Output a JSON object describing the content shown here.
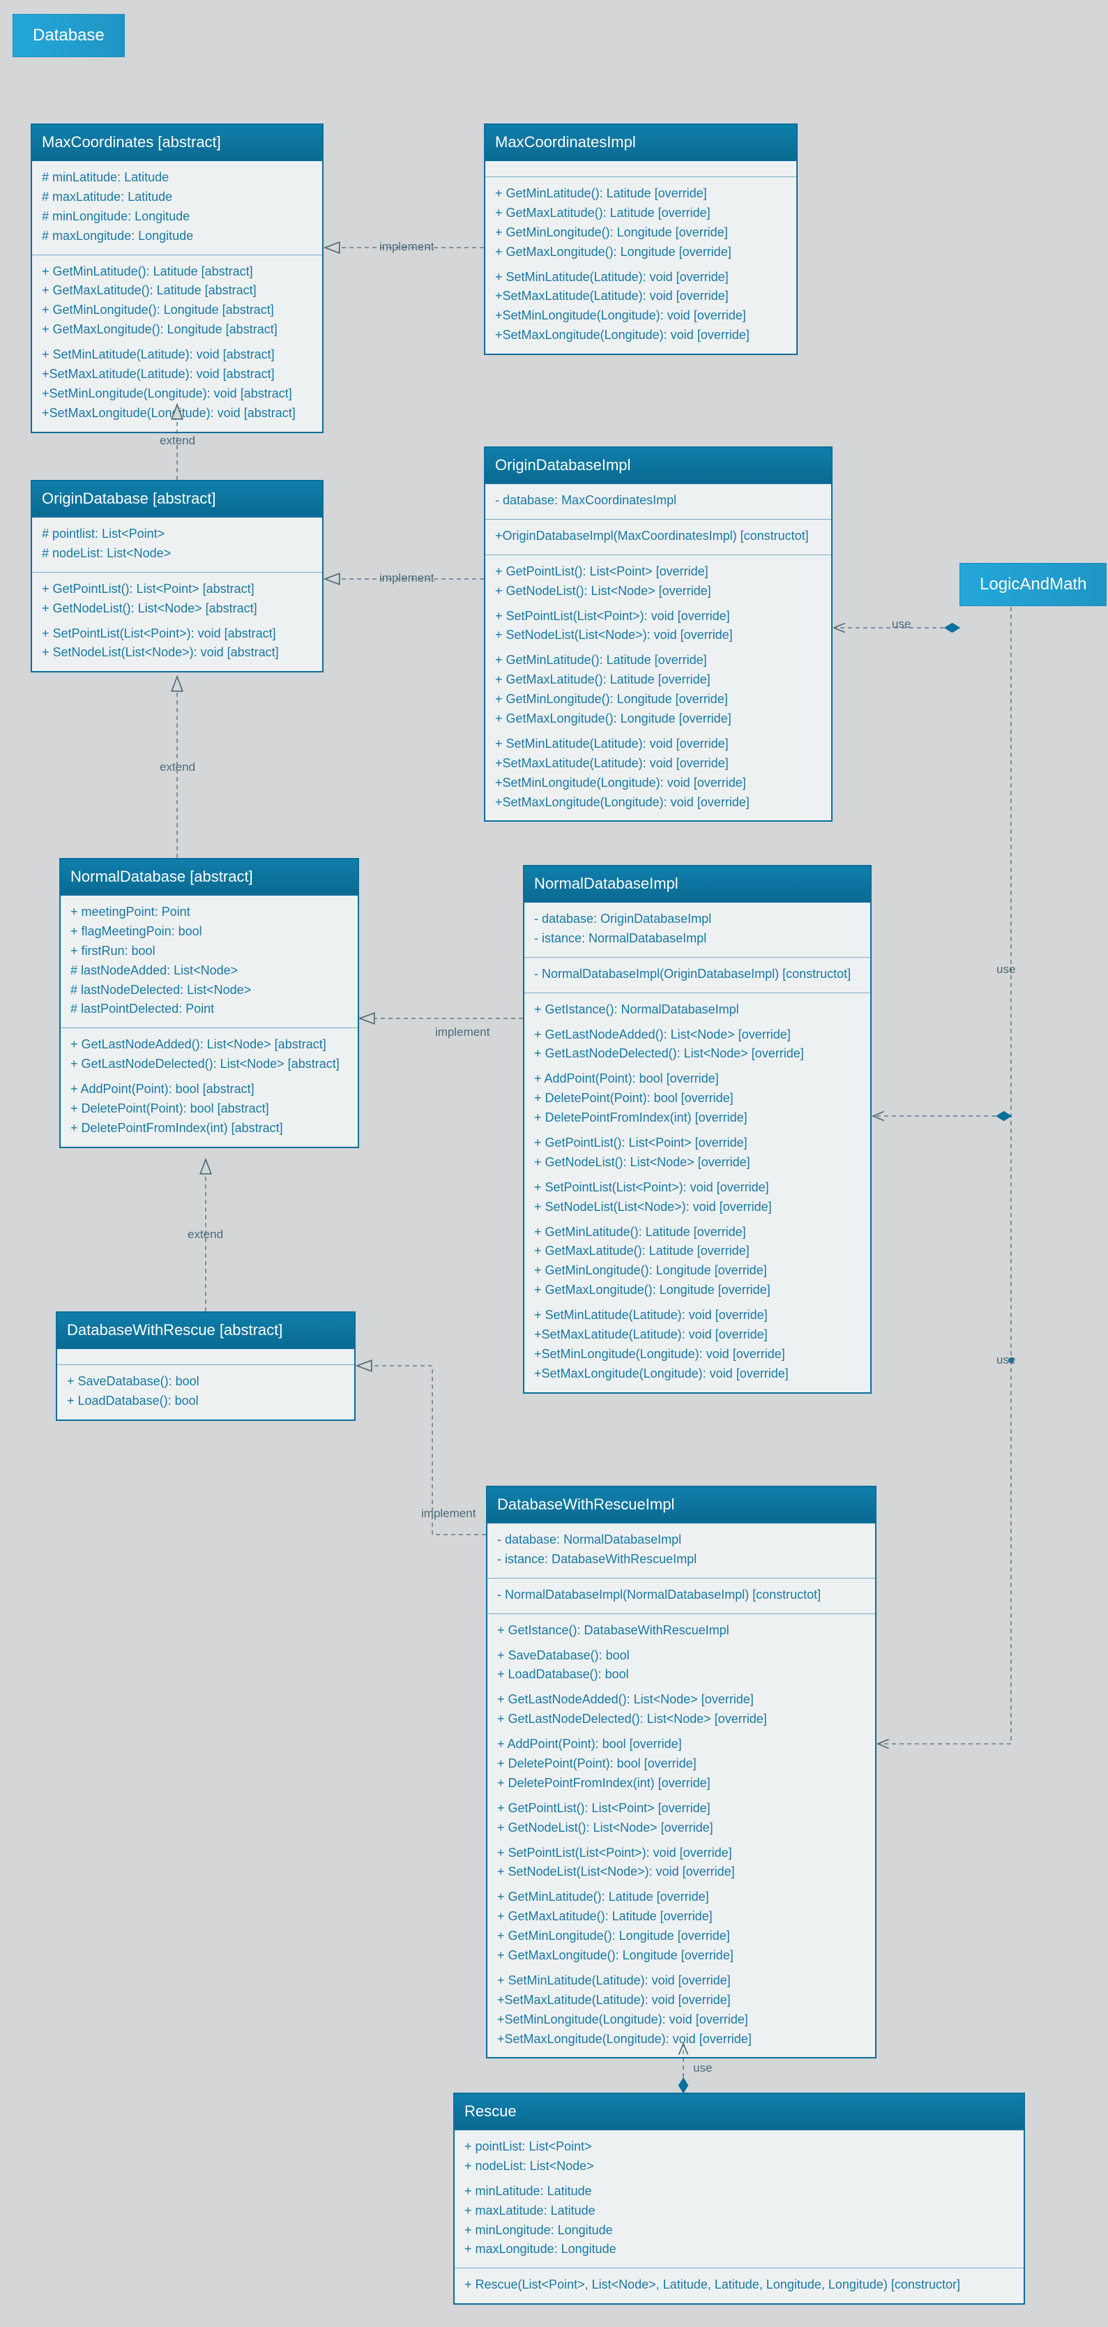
{
  "packages": {
    "database": "Database",
    "logicAndMath": "LogicAndMath"
  },
  "edges": {
    "implement": "implement",
    "extend": "extend",
    "use": "use"
  },
  "classes": {
    "MaxCoordinates": {
      "title": "MaxCoordinates [abstract]",
      "fields": [
        "# minLatitude: Latitude",
        "# maxLatitude: Latitude",
        "# minLongitude: Longitude",
        "# maxLongitude: Longitude"
      ],
      "methods1": [
        "+ GetMinLatitude(): Latitude [abstract]",
        "+ GetMaxLatitude(): Latitude [abstract]",
        "+ GetMinLongitude(): Longitude [abstract]",
        "+ GetMaxLongitude(): Longitude [abstract]"
      ],
      "methods2": [
        "+ SetMinLatitude(Latitude): void [abstract]",
        "+SetMaxLatitude(Latitude): void [abstract]",
        "+SetMinLongitude(Longitude): void [abstract]",
        "+SetMaxLongitude(Longitude): void [abstract]"
      ]
    },
    "MaxCoordinatesImpl": {
      "title": "MaxCoordinatesImpl",
      "methods1": [
        "+ GetMinLatitude(): Latitude [override]",
        "+ GetMaxLatitude(): Latitude [override]",
        "+ GetMinLongitude(): Longitude [override]",
        "+ GetMaxLongitude(): Longitude [override]"
      ],
      "methods2": [
        "+ SetMinLatitude(Latitude): void [override]",
        "+SetMaxLatitude(Latitude): void [override]",
        "+SetMinLongitude(Longitude): void [override]",
        "+SetMaxLongitude(Longitude): void [override]"
      ]
    },
    "OriginDatabase": {
      "title": "OriginDatabase [abstract]",
      "fields": [
        "#  pointlist: List<Point>",
        "# nodeList: List<Node>"
      ],
      "methods1": [
        "+ GetPointList(): List<Point> [abstract]",
        "+ GetNodeList(): List<Node> [abstract]"
      ],
      "methods2": [
        "+ SetPointList(List<Point>): void [abstract]",
        "+ SetNodeList(List<Node>): void [abstract]"
      ]
    },
    "OriginDatabaseImpl": {
      "title": "OriginDatabaseImpl",
      "fields": [
        "- database: MaxCoordinatesImpl"
      ],
      "ctor": [
        "+OriginDatabaseImpl(MaxCoordinatesImpl) [constructot]"
      ],
      "m1": [
        "+ GetPointList(): List<Point> [override]",
        "+ GetNodeList(): List<Node> [override]"
      ],
      "m2": [
        "+ SetPointList(List<Point>): void [override]",
        "+ SetNodeList(List<Node>): void [override]"
      ],
      "m3": [
        "+ GetMinLatitude(): Latitude [override]",
        "+ GetMaxLatitude(): Latitude [override]",
        "+ GetMinLongitude(): Longitude [override]",
        "+ GetMaxLongitude(): Longitude [override]"
      ],
      "m4": [
        "+ SetMinLatitude(Latitude): void [override]",
        "+SetMaxLatitude(Latitude): void [override]",
        "+SetMinLongitude(Longitude): void [override]",
        "+SetMaxLongitude(Longitude): void [override]"
      ]
    },
    "NormalDatabase": {
      "title": "NormalDatabase [abstract]",
      "fields": [
        "+ meetingPoint: Point",
        "+ flagMeetingPoin: bool",
        "+ firstRun: bool",
        "# lastNodeAdded: List<Node>",
        "# lastNodeDelected: List<Node>",
        "# lastPointDelected: Point"
      ],
      "m1": [
        "+ GetLastNodeAdded(): List<Node> [abstract]",
        "+ GetLastNodeDelected(): List<Node> [abstract]"
      ],
      "m2": [
        "+ AddPoint(Point): bool [abstract]",
        "+ DeletePoint(Point): bool [abstract]",
        "+ DeletePointFromIndex(int) [abstract]"
      ]
    },
    "NormalDatabaseImpl": {
      "title": "NormalDatabaseImpl",
      "fields": [
        "- database: OriginDatabaseImpl",
        "- istance: NormalDatabaseImpl"
      ],
      "ctor": [
        "- NormalDatabaseImpl(OriginDatabaseImpl) [constructot]"
      ],
      "m0": [
        "+ GetIstance(): NormalDatabaseImpl"
      ],
      "m1": [
        "+ GetLastNodeAdded(): List<Node> [override]",
        "+ GetLastNodeDelected(): List<Node> [override]"
      ],
      "m2": [
        "+ AddPoint(Point): bool [override]",
        "+ DeletePoint(Point): bool [override]",
        "+ DeletePointFromIndex(int) [override]"
      ],
      "m3": [
        "+ GetPointList(): List<Point> [override]",
        "+ GetNodeList(): List<Node> [override]"
      ],
      "m4": [
        "+ SetPointList(List<Point>): void [override]",
        "+ SetNodeList(List<Node>): void [override]"
      ],
      "m5": [
        "+ GetMinLatitude(): Latitude [override]",
        "+ GetMaxLatitude(): Latitude [override]",
        "+ GetMinLongitude(): Longitude [override]",
        "+ GetMaxLongitude(): Longitude [override]"
      ],
      "m6": [
        "+ SetMinLatitude(Latitude): void [override]",
        "+SetMaxLatitude(Latitude): void [override]",
        "+SetMinLongitude(Longitude): void [override]",
        "+SetMaxLongitude(Longitude): void [override]"
      ]
    },
    "DatabaseWithRescue": {
      "title": "DatabaseWithRescue [abstract]",
      "m1": [
        "+ SaveDatabase(): bool",
        "+ LoadDatabase(): bool"
      ]
    },
    "DatabaseWithRescueImpl": {
      "title": "DatabaseWithRescueImpl",
      "fields": [
        "- database: NormalDatabaseImpl",
        "- istance: DatabaseWithRescueImpl"
      ],
      "ctor": [
        "- NormalDatabaseImpl(NormalDatabaseImpl) [constructot]"
      ],
      "m0": [
        "+ GetIstance(): DatabaseWithRescueImpl"
      ],
      "m00": [
        "+ SaveDatabase(): bool",
        "+ LoadDatabase(): bool"
      ],
      "m1": [
        "+ GetLastNodeAdded(): List<Node> [override]",
        "+ GetLastNodeDelected(): List<Node> [override]"
      ],
      "m2": [
        "+ AddPoint(Point): bool [override]",
        "+ DeletePoint(Point): bool [override]",
        "+ DeletePointFromIndex(int) [override]"
      ],
      "m3": [
        "+ GetPointList(): List<Point> [override]",
        "+ GetNodeList(): List<Node> [override]"
      ],
      "m4": [
        "+ SetPointList(List<Point>): void [override]",
        "+ SetNodeList(List<Node>): void [override]"
      ],
      "m5": [
        "+ GetMinLatitude(): Latitude [override]",
        "+ GetMaxLatitude(): Latitude [override]",
        "+ GetMinLongitude(): Longitude [override]",
        "+ GetMaxLongitude(): Longitude [override]"
      ],
      "m6": [
        "+ SetMinLatitude(Latitude): void [override]",
        "+SetMaxLatitude(Latitude): void [override]",
        "+SetMinLongitude(Longitude): void [override]",
        "+SetMaxLongitude(Longitude): void [override]"
      ]
    },
    "Rescue": {
      "title": "Rescue",
      "fields": [
        "+ pointList: List<Point>",
        "+ nodeList: List<Node>"
      ],
      "f2": [
        "+ minLatitude: Latitude",
        "+ maxLatitude: Latitude",
        "+ minLongitude: Longitude",
        "+ maxLongitude: Longitude"
      ],
      "ctor": [
        "+ Rescue(List<Point>, List<Node>, Latitude, Latitude, Longitude, Longitude) [constructor]"
      ]
    }
  }
}
